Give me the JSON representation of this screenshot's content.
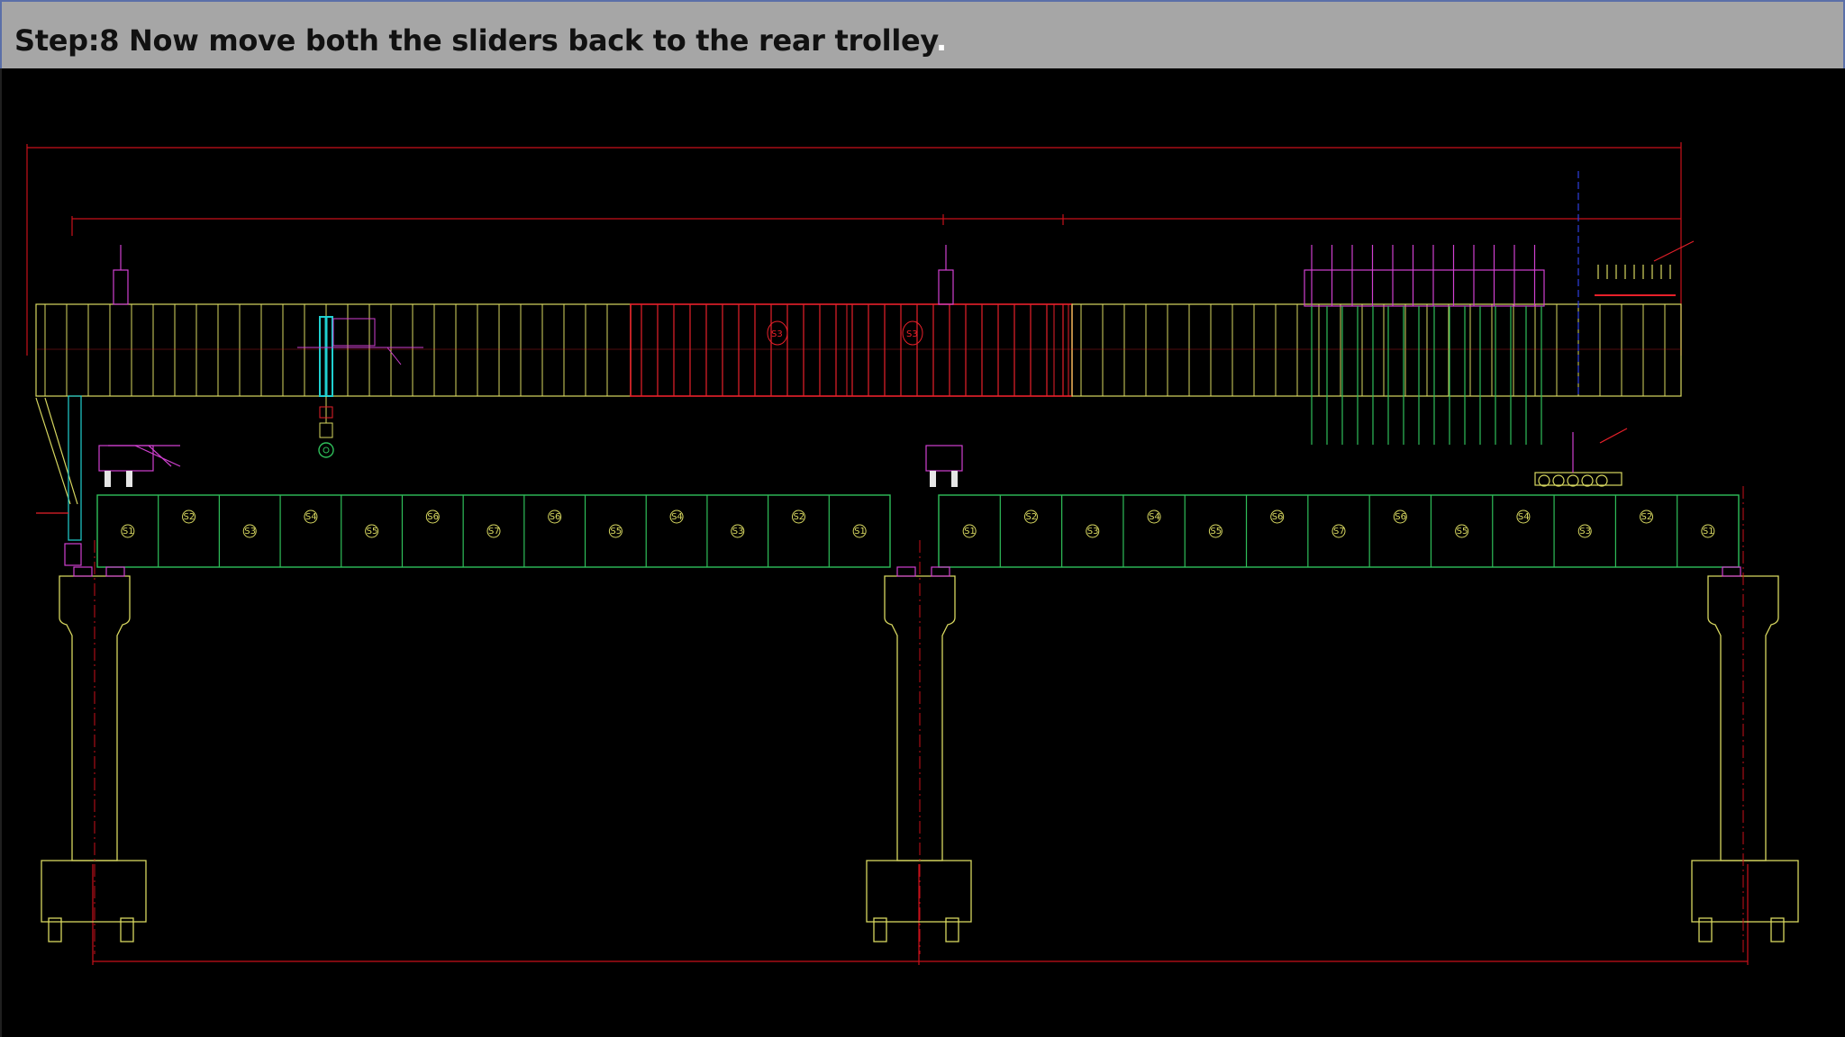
{
  "slide": {
    "title": "Step:8 Now move both the sliders back to the rear trolley",
    "title_trailing": "."
  },
  "drawing": {
    "segment_labels": [
      "S1",
      "S2",
      "S3",
      "S4",
      "S5",
      "S6",
      "S7",
      "S6",
      "S5",
      "S4",
      "S3",
      "S2",
      "S1"
    ],
    "girder_labels": [
      "S3",
      "S3"
    ],
    "colors": {
      "background": "#000000",
      "title_bar": "#a6a6a6",
      "girder_red": "#e8202a",
      "deck_green": "#2fbf5a",
      "pier_yellow": "#d8d860",
      "truss_magenta": "#d040d0",
      "dimension_red": "#c8101a",
      "cyan": "#20d0d0",
      "blue": "#3040e0"
    }
  }
}
